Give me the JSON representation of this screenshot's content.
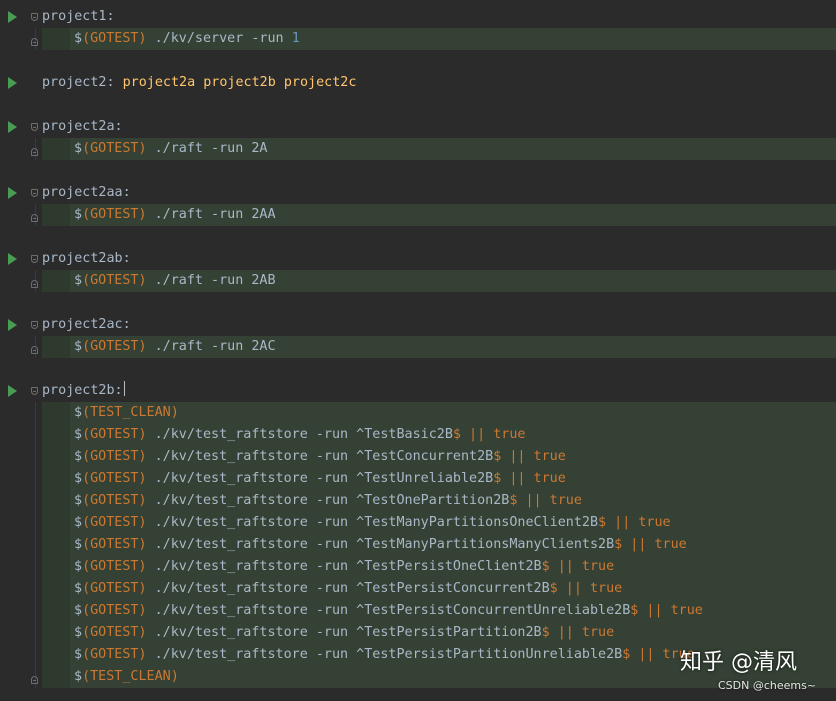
{
  "editor": {
    "blocks": [
      {
        "target": "project1:",
        "deps": "",
        "recipes": [
          {
            "var": "(GOTEST)",
            "cmd": " ./kv/server -run ",
            "num": "1",
            "tail": ""
          }
        ]
      },
      {
        "target": "project2: ",
        "deps": "project2a project2b project2c",
        "recipes": []
      },
      {
        "target": "project2a:",
        "deps": "",
        "recipes": [
          {
            "var": "(GOTEST)",
            "cmd": " ./raft -run 2A",
            "num": "",
            "tail": ""
          }
        ]
      },
      {
        "target": "project2aa:",
        "deps": "",
        "recipes": [
          {
            "var": "(GOTEST)",
            "cmd": " ./raft -run 2AA",
            "num": "",
            "tail": ""
          }
        ]
      },
      {
        "target": "project2ab:",
        "deps": "",
        "recipes": [
          {
            "var": "(GOTEST)",
            "cmd": " ./raft -run 2AB",
            "num": "",
            "tail": ""
          }
        ]
      },
      {
        "target": "project2ac:",
        "deps": "",
        "recipes": [
          {
            "var": "(GOTEST)",
            "cmd": " ./raft -run 2AC",
            "num": "",
            "tail": ""
          }
        ]
      },
      {
        "target": "project2b:",
        "deps": "",
        "caret": true,
        "recipes": [
          {
            "var": "(TEST_CLEAN)",
            "cmd": "",
            "num": "",
            "tail": ""
          },
          {
            "var": "(GOTEST)",
            "cmd": " ./kv/test_raftstore -run ^TestBasic2B",
            "num": "",
            "tail": "$ || true"
          },
          {
            "var": "(GOTEST)",
            "cmd": " ./kv/test_raftstore -run ^TestConcurrent2B",
            "num": "",
            "tail": "$ || true"
          },
          {
            "var": "(GOTEST)",
            "cmd": " ./kv/test_raftstore -run ^TestUnreliable2B",
            "num": "",
            "tail": "$ || true"
          },
          {
            "var": "(GOTEST)",
            "cmd": " ./kv/test_raftstore -run ^TestOnePartition2B",
            "num": "",
            "tail": "$ || true"
          },
          {
            "var": "(GOTEST)",
            "cmd": " ./kv/test_raftstore -run ^TestManyPartitionsOneClient2B",
            "num": "",
            "tail": "$ || true"
          },
          {
            "var": "(GOTEST)",
            "cmd": " ./kv/test_raftstore -run ^TestManyPartitionsManyClients2B",
            "num": "",
            "tail": "$ || true"
          },
          {
            "var": "(GOTEST)",
            "cmd": " ./kv/test_raftstore -run ^TestPersistOneClient2B",
            "num": "",
            "tail": "$ || true"
          },
          {
            "var": "(GOTEST)",
            "cmd": " ./kv/test_raftstore -run ^TestPersistConcurrent2B",
            "num": "",
            "tail": "$ || true"
          },
          {
            "var": "(GOTEST)",
            "cmd": " ./kv/test_raftstore -run ^TestPersistConcurrentUnreliable2B",
            "num": "",
            "tail": "$ || true"
          },
          {
            "var": "(GOTEST)",
            "cmd": " ./kv/test_raftstore -run ^TestPersistPartition2B",
            "num": "",
            "tail": "$ || true"
          },
          {
            "var": "(GOTEST)",
            "cmd": " ./kv/test_raftstore -run ^TestPersistPartitionUnreliable2B",
            "num": "",
            "tail": "$ || true"
          },
          {
            "var": "(TEST_CLEAN)",
            "cmd": "",
            "num": "",
            "tail": ""
          }
        ]
      }
    ]
  },
  "watermark": {
    "zhihu": "知乎 @清风",
    "csdn": "CSDN @cheems~"
  },
  "colors": {
    "background": "#2b2b2b",
    "recipe_bg": "#344134",
    "run_icon": "#499c54",
    "variable": "#cc7832",
    "target": "#a9b7c6",
    "dependency": "#ffc66d",
    "number": "#6897bb"
  },
  "icons": {
    "gutter": "run-triangle-icon",
    "fold": "fold-marker-icon"
  }
}
